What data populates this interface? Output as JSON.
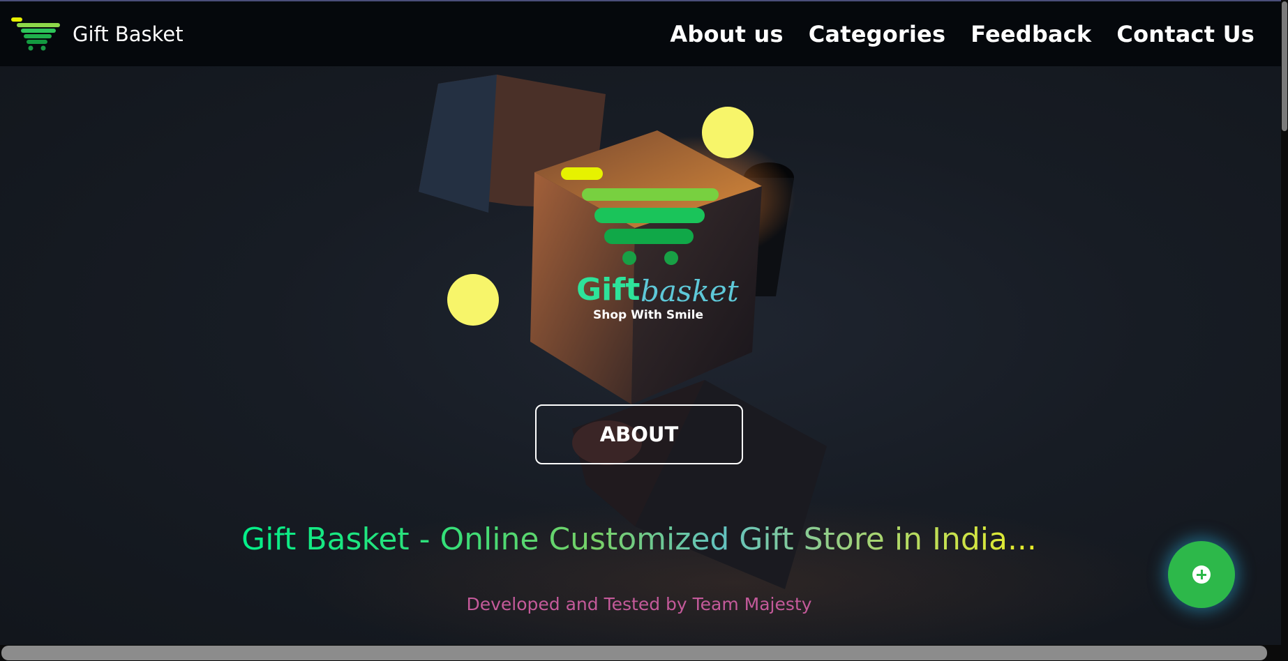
{
  "navbar": {
    "brand_name": "Gift Basket",
    "links": [
      {
        "label": "About us"
      },
      {
        "label": "Categories"
      },
      {
        "label": "Feedback"
      },
      {
        "label": "Contact Us"
      }
    ]
  },
  "hero": {
    "logo": {
      "word_gift": "Gift",
      "word_basket": "basket",
      "tagline": "Shop With Smile"
    },
    "about_button": "ABOUT",
    "headline": "Gift Basket - Online Customized Gift Store in India...",
    "credit": "Developed and Tested by Team Majesty"
  },
  "fab": {
    "icon": "plus-circle-icon"
  },
  "colors": {
    "accent_green": "#2db84a",
    "headline_start": "#00f08a",
    "headline_end": "#f0f020",
    "credit": "#c45a9a",
    "navbar_bg": "#05080c"
  }
}
